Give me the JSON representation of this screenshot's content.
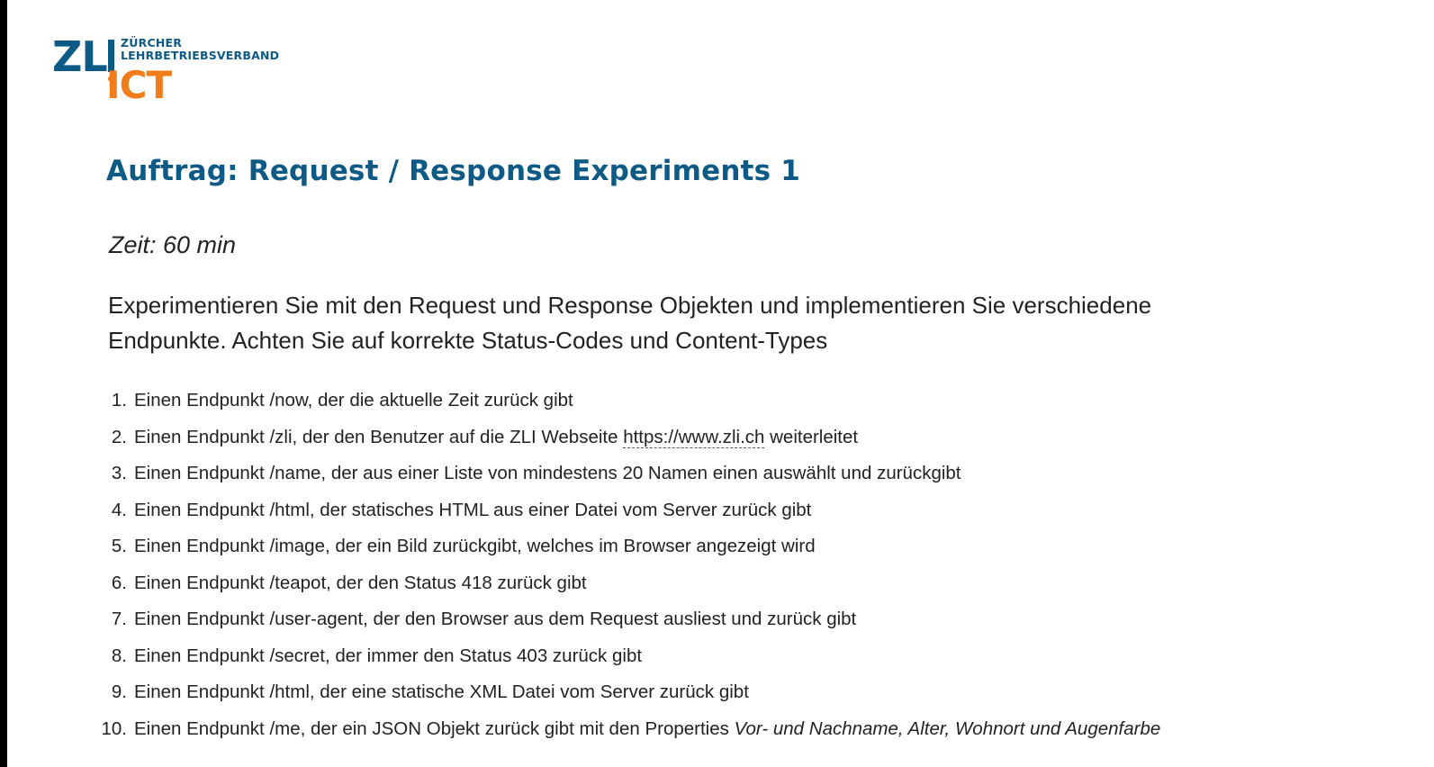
{
  "logo": {
    "zl": "ZL",
    "ict": "ICT",
    "org_line1": "ZÜRCHER",
    "org_line2": "LEHRBETRIEBSVERBAND",
    "colors": {
      "blue": "#0d5a86",
      "orange": "#f07d1a"
    }
  },
  "title": "Auftrag: Request / Response Experiments 1",
  "time": "Zeit: 60 min",
  "intro": "Experimentieren Sie mit den Request und Response Objekten und implementieren Sie verschiedene Endpunkte. Achten Sie auf korrekte Status-Codes und Content-Types",
  "tasks": [
    {
      "num": "1.",
      "text": "Einen Endpunkt /now, der die aktuelle Zeit zurück gibt"
    },
    {
      "num": "2.",
      "text_before": "Einen Endpunkt /zli, der den Benutzer auf die ZLI Webseite ",
      "link": "https://www.zli.ch",
      "text_after": " weiterleitet"
    },
    {
      "num": "3.",
      "text": "Einen Endpunkt /name, der aus einer Liste von mindestens 20 Namen einen auswählt und zurückgibt"
    },
    {
      "num": "4.",
      "text": "Einen Endpunkt /html, der statisches HTML aus einer Datei vom Server zurück gibt"
    },
    {
      "num": "5.",
      "text": "Einen Endpunkt /image, der ein Bild zurückgibt, welches im Browser angezeigt wird"
    },
    {
      "num": "6.",
      "text": "Einen Endpunkt /teapot, der den Status 418 zurück gibt"
    },
    {
      "num": "7.",
      "text": "Einen Endpunkt /user-agent, der den Browser aus dem Request ausliest und zurück gibt"
    },
    {
      "num": "8.",
      "text": "Einen Endpunkt /secret, der immer den Status 403 zurück gibt"
    },
    {
      "num": "9.",
      "text": "Einen Endpunkt /html, der eine statische XML Datei vom Server zurück gibt"
    },
    {
      "num": "10.",
      "text_before": "Einen Endpunkt /me, der ein JSON Objekt zurück gibt mit den Properties ",
      "emphasis": "Vor- und Nachname, Alter, Wohnort und Augenfarbe"
    }
  ]
}
